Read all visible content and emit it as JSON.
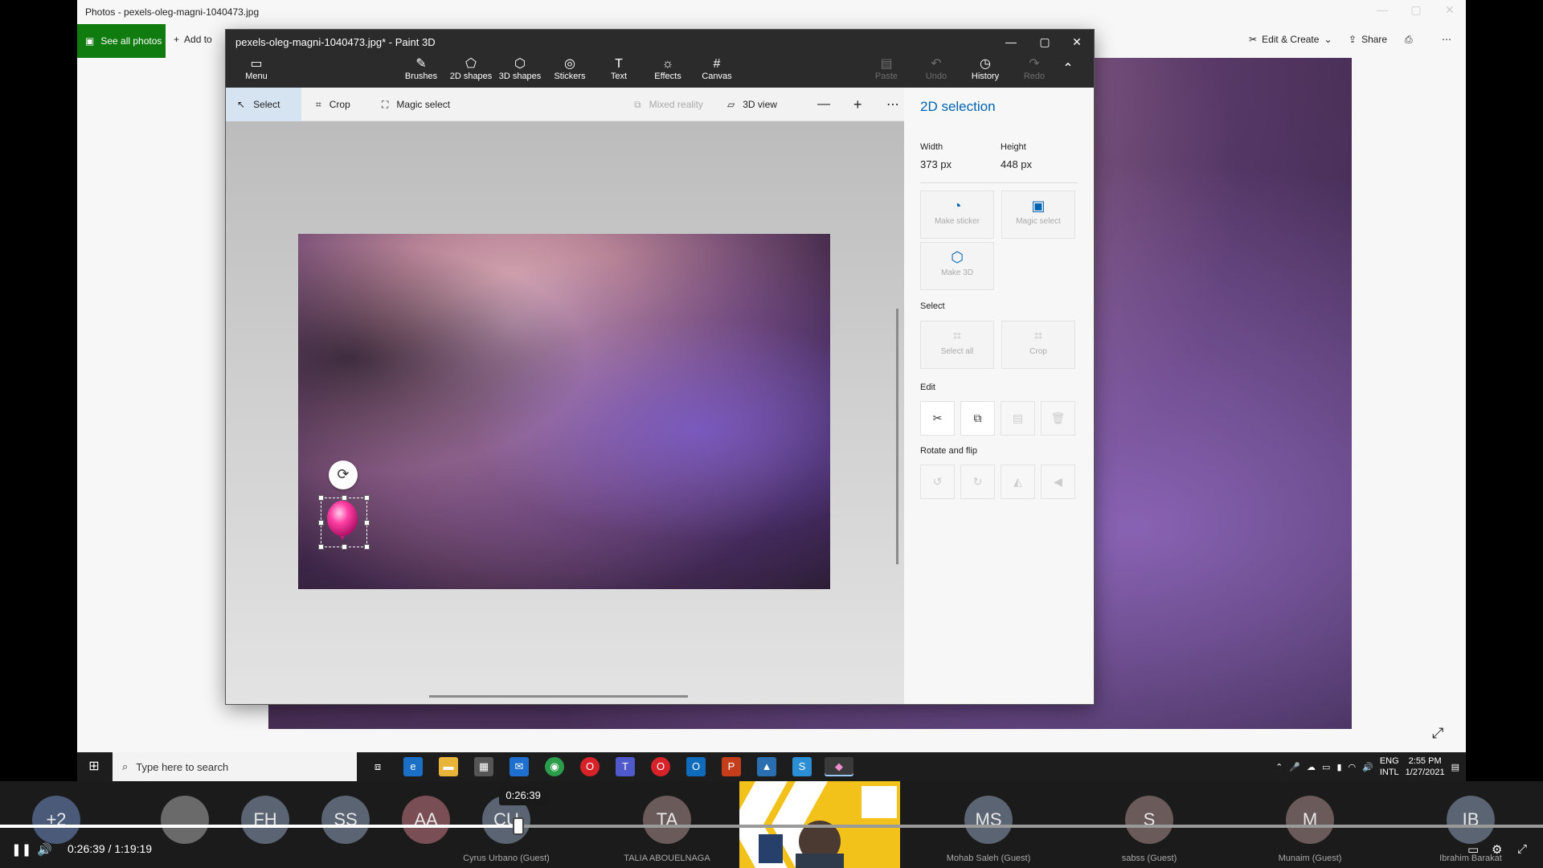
{
  "photos": {
    "window_title": "Photos - pexels-oleg-magni-1040473.jpg",
    "see_all_label": "See all photos",
    "add_to_label": "Add to",
    "edit_create_label": "Edit & Create",
    "share_label": "Share"
  },
  "paint": {
    "window_title": "pexels-oleg-magni-1040473.jpg* - Paint 3D",
    "ribbon": {
      "menu": "Menu",
      "brushes": "Brushes",
      "shapes2d": "2D shapes",
      "shapes3d": "3D shapes",
      "stickers": "Stickers",
      "text": "Text",
      "effects": "Effects",
      "canvas": "Canvas",
      "paste": "Paste",
      "undo": "Undo",
      "history": "History",
      "redo": "Redo"
    },
    "subbar": {
      "select": "Select",
      "crop": "Crop",
      "magic_select": "Magic select",
      "mixed_reality": "Mixed reality",
      "view_3d": "3D view"
    },
    "panel": {
      "title": "2D selection",
      "width_label": "Width",
      "height_label": "Height",
      "width_value": "373 px",
      "height_value": "448 px",
      "make_sticker": "Make sticker",
      "magic_select": "Magic select",
      "make_3d": "Make 3D",
      "select_section": "Select",
      "select_all": "Select all",
      "crop": "Crop",
      "edit_section": "Edit",
      "rotate_section": "Rotate and flip"
    }
  },
  "taskbar": {
    "search_placeholder": "Type here to search",
    "lang_top": "ENG",
    "lang_bottom": "INTL",
    "time": "2:55 PM",
    "date": "1/27/2021"
  },
  "meeting": {
    "participants": [
      {
        "initials": "+2",
        "name": ""
      },
      {
        "initials": "",
        "name": ""
      },
      {
        "initials": "FH",
        "name": ""
      },
      {
        "initials": "SS",
        "name": ""
      },
      {
        "initials": "AA",
        "name": ""
      },
      {
        "initials": "CU",
        "name": "Cyrus Urbano (Guest)"
      },
      {
        "initials": "TA",
        "name": "TALIA ABOUELNAGA"
      },
      {
        "initials": "MS",
        "name": "Mohab Saleh (Guest)"
      },
      {
        "initials": "S",
        "name": "sabss (Guest)"
      },
      {
        "initials": "M",
        "name": "Munaim (Guest)"
      },
      {
        "initials": "IB",
        "name": "Ibrahim Barakat"
      }
    ]
  },
  "player": {
    "current_time": "0:26:39",
    "time_display": "0:26:39  /  1:19:19",
    "progress_fraction": 0.336
  },
  "colors": {
    "paint_dark": "#2b2b2b",
    "accent_blue": "#0063b1",
    "photos_green": "#107c10",
    "balloon_pink": "#ff3fa4"
  }
}
